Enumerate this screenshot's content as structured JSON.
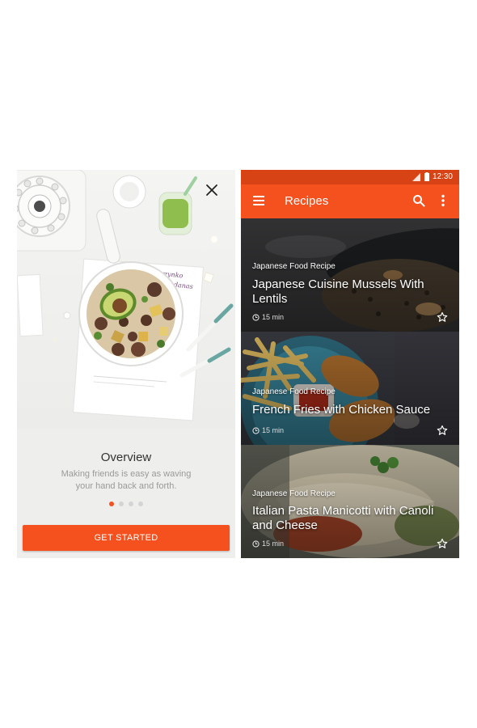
{
  "onboarding": {
    "title": "Overview",
    "subtitle": "Making friends is easy as waving your hand back and forth.",
    "cta_label": "GET STARTED",
    "page_count": 4,
    "active_page": 1,
    "close_icon": "close-icon",
    "handwritten_note": "Brzynko randanas"
  },
  "statusbar": {
    "time": "12:30"
  },
  "appbar": {
    "title": "Recipes",
    "menu_icon": "menu-icon",
    "search_icon": "search-icon",
    "more_icon": "more-vert-icon"
  },
  "recipes": [
    {
      "category": "Japanese Food Recipe",
      "title": "Japanese Cuisine Mussels With Lentils",
      "time": "15 min"
    },
    {
      "category": "Japanese Food Recipe",
      "title": "French Fries with Chicken Sauce",
      "time": "15 min"
    },
    {
      "category": "Japanese Food Recipe",
      "title": "Italian Pasta Manicotti with Canoli and Cheese",
      "time": "15 min"
    }
  ],
  "colors": {
    "accent": "#f4511e",
    "status_bar": "#d84315"
  }
}
